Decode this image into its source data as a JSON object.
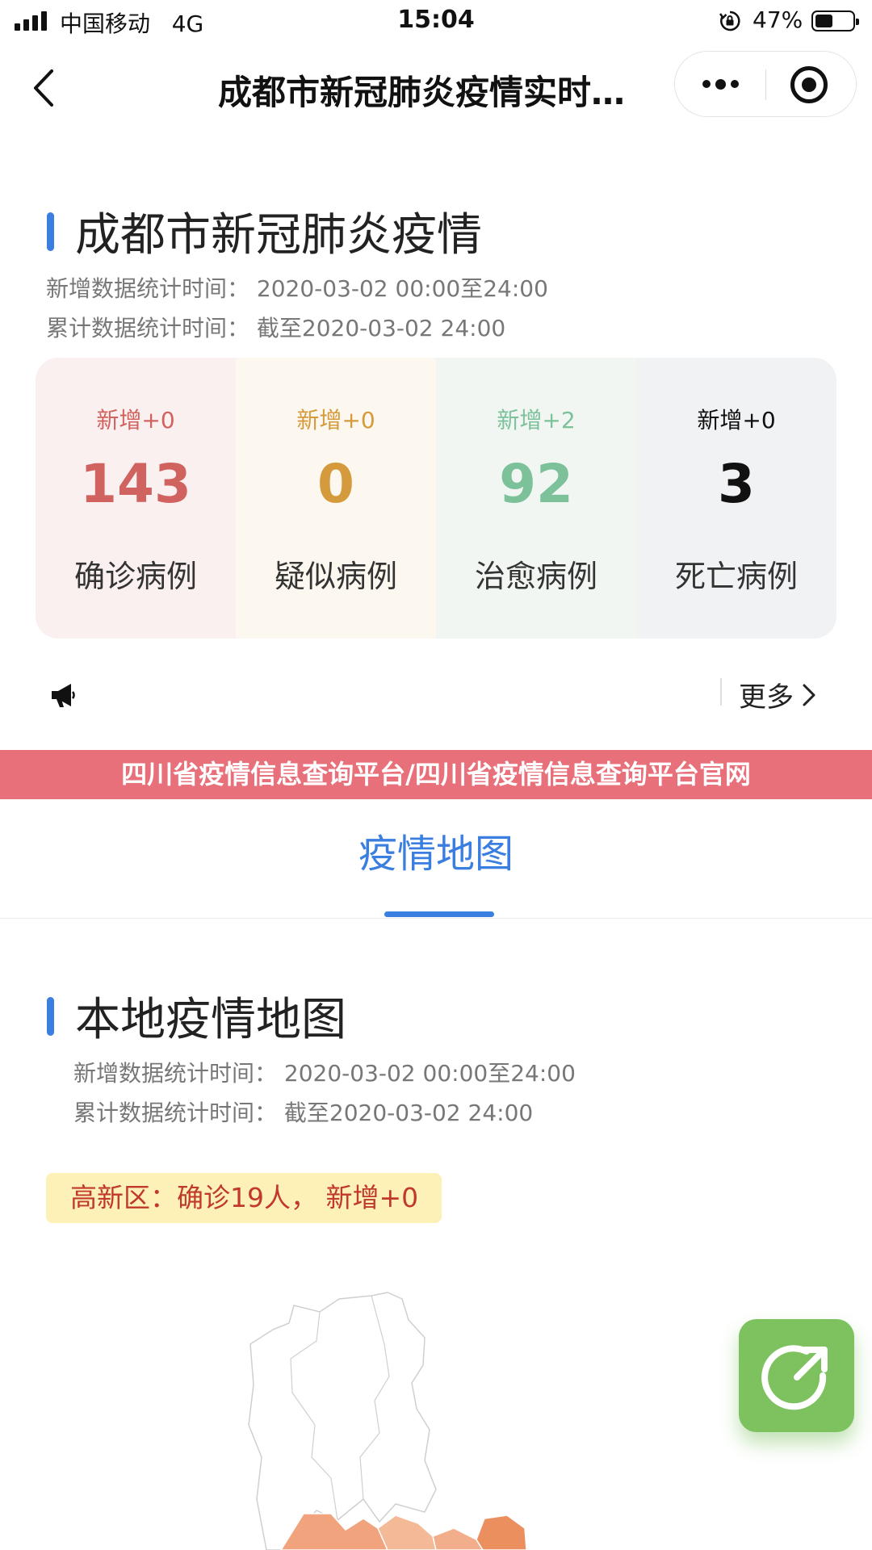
{
  "status_bar": {
    "carrier": "中国移动",
    "network": "4G",
    "time": "15:04",
    "battery": "47%",
    "battery_level": 0.47
  },
  "nav": {
    "title": "成都市新冠肺炎疫情实时动态",
    "icons": [
      "back-icon",
      "more-icon",
      "target-icon"
    ]
  },
  "city_section": {
    "title": "成都市新冠肺炎疫情",
    "new_time": "新增数据统计时间：  2020-03-02 00:00至24:00",
    "total_time": "累计数据统计时间：  截至2020-03-02 24:00"
  },
  "stats": [
    {
      "increase": "新增+0",
      "value": "143",
      "label": "确诊病例",
      "color": "#d0625f",
      "bg": "#fbf0f0"
    },
    {
      "increase": "新增+0",
      "value": "0",
      "label": "疑似病例",
      "color": "#d49a3c",
      "bg": "#fdf8ef"
    },
    {
      "increase": "新增+2",
      "value": "92",
      "label": "治愈病例",
      "color": "#7cc19a",
      "bg": "#f1f6f3"
    },
    {
      "increase": "新增+0",
      "value": "3",
      "label": "死亡病例",
      "color": "#111111",
      "bg": "#f1f2f4"
    }
  ],
  "notice": {
    "icon": "megaphone-icon",
    "more_label": "更多"
  },
  "banner": {
    "text": "四川省疫情信息查询平台/四川省疫情信息查询平台官网"
  },
  "tab": {
    "label": "疫情地图"
  },
  "map_section": {
    "title": "本地疫情地图",
    "new_time": "新增数据统计时间：  2020-03-02 00:00至24:00",
    "total_time": "累计数据统计时间：  截至2020-03-02 24:00",
    "district": "高新区：确诊19人，  新增+0"
  },
  "share": {
    "icon": "share-icon",
    "color": "#7ec25f"
  }
}
